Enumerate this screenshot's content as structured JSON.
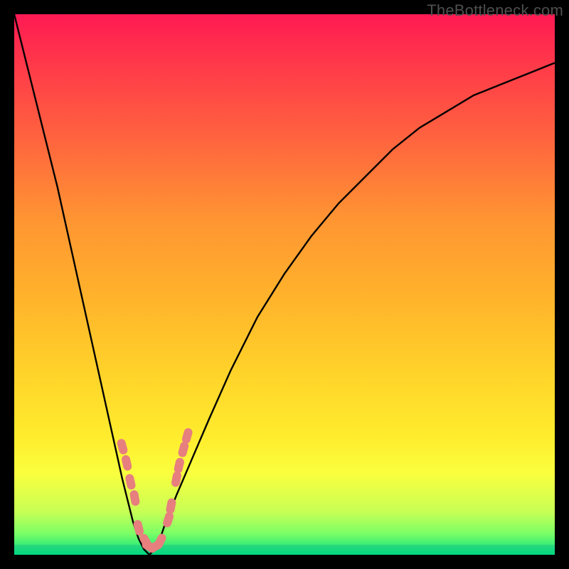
{
  "watermark": "TheBottleneck.com",
  "colors": {
    "background_black": "#000000",
    "curve_stroke": "#000000",
    "marker_fill": "#e77f7f",
    "gradient_top": "#ff1a53",
    "gradient_bottom": "#00d780"
  },
  "chart_data": {
    "type": "line",
    "title": "",
    "xlabel": "",
    "ylabel": "",
    "xlim": [
      0,
      100
    ],
    "ylim": [
      0,
      100
    ],
    "series": [
      {
        "name": "bottleneck-curve",
        "x": [
          0,
          2,
          4,
          6,
          8,
          10,
          12,
          14,
          16,
          18,
          20,
          21,
          22,
          23,
          24,
          25,
          26,
          27,
          28,
          30,
          33,
          36,
          40,
          45,
          50,
          55,
          60,
          65,
          70,
          75,
          80,
          85,
          90,
          95,
          100
        ],
        "y": [
          100,
          92,
          84,
          76,
          68,
          59,
          50,
          41,
          32,
          23,
          14,
          10,
          6,
          3,
          1,
          0,
          1,
          3,
          6,
          11,
          18,
          25,
          34,
          44,
          52,
          59,
          65,
          70,
          75,
          79,
          82,
          85,
          87,
          89,
          91
        ]
      }
    ],
    "markers": [
      {
        "x": 20.0,
        "y": 20.0
      },
      {
        "x": 20.8,
        "y": 17.0
      },
      {
        "x": 21.5,
        "y": 13.5
      },
      {
        "x": 22.3,
        "y": 10.5
      },
      {
        "x": 23.0,
        "y": 5.0
      },
      {
        "x": 24.3,
        "y": 2.5
      },
      {
        "x": 25.0,
        "y": 1.5
      },
      {
        "x": 26.0,
        "y": 1.5
      },
      {
        "x": 27.0,
        "y": 2.5
      },
      {
        "x": 28.5,
        "y": 6.5
      },
      {
        "x": 29.0,
        "y": 9.0
      },
      {
        "x": 30.0,
        "y": 14.0
      },
      {
        "x": 30.5,
        "y": 16.5
      },
      {
        "x": 31.3,
        "y": 19.5
      },
      {
        "x": 32.0,
        "y": 22.0
      }
    ]
  }
}
